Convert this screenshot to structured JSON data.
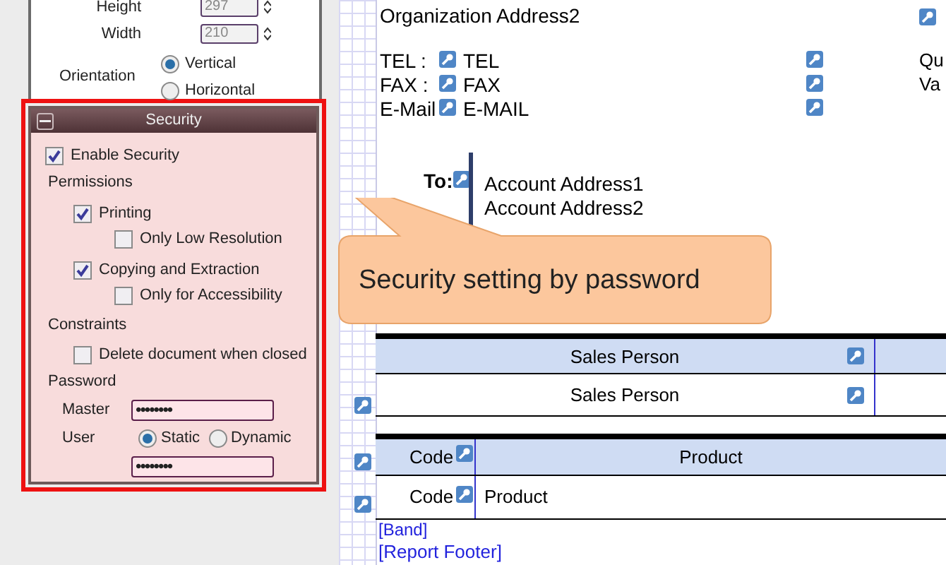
{
  "page_settings": {
    "height_label": "Height",
    "height_value": "297",
    "width_label": "Width",
    "width_value": "210",
    "orientation_label": "Orientation",
    "orientations": [
      {
        "label": "Vertical",
        "selected": true
      },
      {
        "label": "Horizontal",
        "selected": false
      }
    ]
  },
  "security": {
    "title": "Security",
    "enable": {
      "label": "Enable Security",
      "checked": true
    },
    "permissions_label": "Permissions",
    "permissions": [
      {
        "label": "Printing",
        "checked": true,
        "children": [
          {
            "label": "Only Low Resolution",
            "checked": false
          }
        ]
      },
      {
        "label": "Copying and Extraction",
        "checked": true,
        "children": [
          {
            "label": "Only for Accessibility",
            "checked": false
          }
        ]
      }
    ],
    "constraints_label": "Constraints",
    "constraints": [
      {
        "label": "Delete document when closed",
        "checked": false
      }
    ],
    "password_label": "Password",
    "master_label": "Master",
    "master_value": "••••••••",
    "user_label": "User",
    "user_modes": [
      {
        "label": "Static",
        "selected": true
      },
      {
        "label": "Dynamic",
        "selected": false
      }
    ],
    "user_value": "••••••••"
  },
  "report": {
    "organization_address": "Organization Address2",
    "contacts": [
      {
        "label": "TEL :",
        "value": "TEL"
      },
      {
        "label": "FAX :",
        "value": "FAX"
      },
      {
        "label": "E-Mail",
        "value": "E-MAIL"
      }
    ],
    "cut_labels": [
      "Qu",
      "Va"
    ],
    "to_label": "To:",
    "account_addresses": [
      "Account Address1",
      "Account Address2"
    ],
    "sales_table": {
      "header": "Sales Person",
      "cell": "Sales Person"
    },
    "product_table": {
      "columns": [
        "Code",
        "Product"
      ],
      "row": [
        "Code",
        "Product"
      ]
    },
    "band_label": "[Band]",
    "footer_label": "[Report Footer]"
  },
  "callout": "Security setting by password"
}
